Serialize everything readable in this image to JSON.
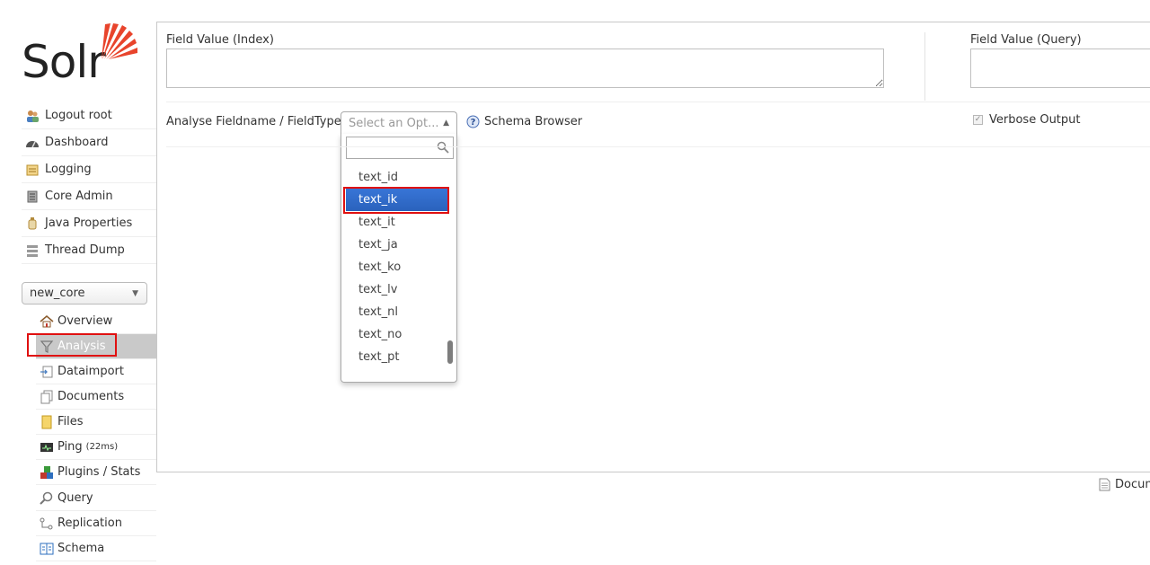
{
  "logo": {
    "text": "Solr"
  },
  "nav": {
    "items": [
      {
        "label": "Logout root",
        "icon": "logout-icon"
      },
      {
        "label": "Dashboard",
        "icon": "dashboard-icon"
      },
      {
        "label": "Logging",
        "icon": "logging-icon"
      },
      {
        "label": "Core Admin",
        "icon": "core-admin-icon"
      },
      {
        "label": "Java Properties",
        "icon": "java-icon"
      },
      {
        "label": "Thread Dump",
        "icon": "thread-dump-icon"
      }
    ]
  },
  "core_selector": {
    "value": "new_core"
  },
  "core_menu": {
    "items": [
      {
        "label": "Overview",
        "icon": "home-icon"
      },
      {
        "label": "Analysis",
        "icon": "filter-icon"
      },
      {
        "label": "Dataimport",
        "icon": "dataimport-icon"
      },
      {
        "label": "Documents",
        "icon": "documents-icon"
      },
      {
        "label": "Files",
        "icon": "files-icon"
      },
      {
        "label": "Ping",
        "extra": "(22ms)",
        "icon": "ping-icon"
      },
      {
        "label": "Plugins / Stats",
        "icon": "plugins-icon"
      },
      {
        "label": "Query",
        "icon": "query-icon"
      },
      {
        "label": "Replication",
        "icon": "replication-icon"
      },
      {
        "label": "Schema",
        "icon": "schema-icon"
      }
    ],
    "active": "Analysis"
  },
  "analysis": {
    "field_value_index_label": "Field Value (Index)",
    "field_value_query_label": "Field Value (Query)",
    "fieldname_label": "Analyse Fieldname / FieldType:",
    "select_placeholder": "Select an Opt...",
    "schema_browser": "Schema Browser",
    "verbose_output": "Verbose Output",
    "dropdown_options": [
      "text_id",
      "text_ik",
      "text_it",
      "text_ja",
      "text_ko",
      "text_lv",
      "text_nl",
      "text_no",
      "text_pt"
    ],
    "selected_option": "text_ik"
  },
  "footer": {
    "documentation": "Docum"
  },
  "colors": {
    "highlight": "#e01010",
    "selected": "#3875d7",
    "logo_accent": "#e8442c"
  }
}
